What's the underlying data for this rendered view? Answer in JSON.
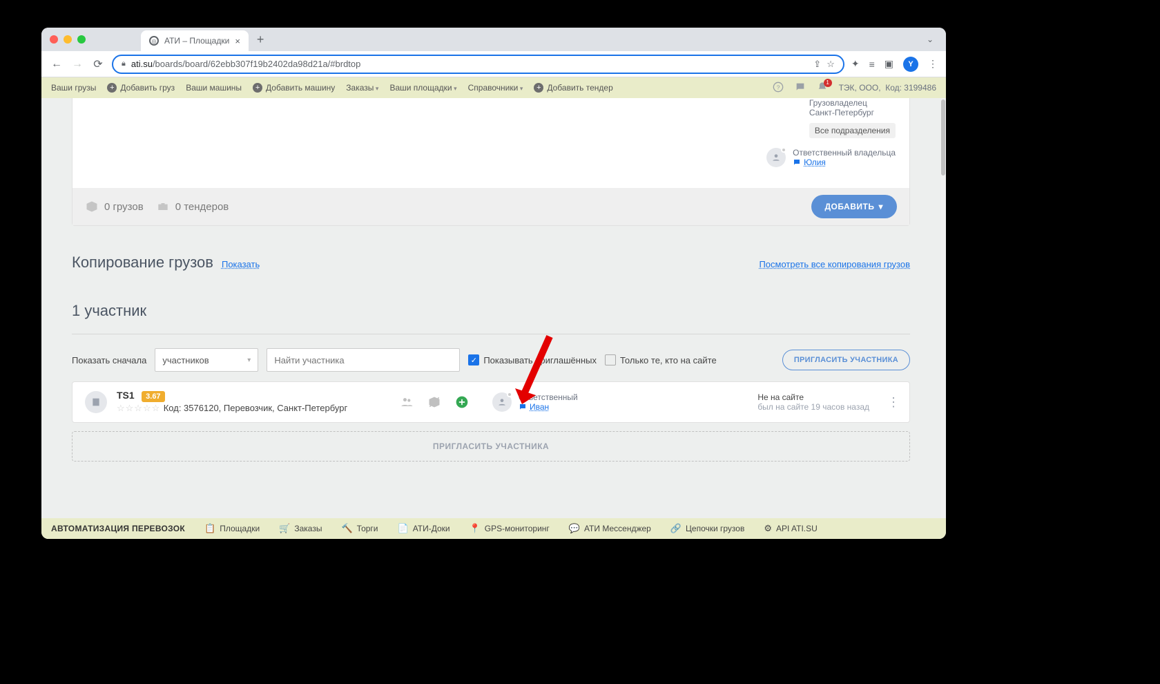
{
  "browser": {
    "tab_title": "АТИ – Площадки",
    "url_host": "ati.su",
    "url_path": "/boards/board/62ebb307f19b2402da98d21a/#brdtop"
  },
  "topnav": {
    "your_cargo": "Ваши грузы",
    "add_cargo": "Добавить груз",
    "your_vehicles": "Ваши машины",
    "add_vehicle": "Добавить машину",
    "orders": "Заказы",
    "your_boards": "Ваши площадки",
    "reference": "Справочники",
    "add_tender": "Добавить тендер",
    "org": "ТЭК, ООО,",
    "code": "Код: 3199486"
  },
  "owner": {
    "role": "Грузовладелец",
    "city": "Санкт-Петербург",
    "all_dept": "Все подразделения",
    "resp_label": "Ответственный владельца",
    "resp_name": "Юлия"
  },
  "stats": {
    "cargo": "0 грузов",
    "tenders": "0 тендеров",
    "add_btn": "ДОБАВИТЬ"
  },
  "copy": {
    "title": "Копирование грузов",
    "show": "Показать",
    "all_link": "Посмотреть все копирования грузов"
  },
  "participants": {
    "count_title": "1 участник",
    "show_first": "Показать сначала",
    "select_value": "участников",
    "search_placeholder": "Найти участника",
    "chk_invited": "Показывать приглашённых",
    "chk_online": "Только те, кто на сайте",
    "invite_btn": "ПРИГЛАСИТЬ УЧАСТНИКА",
    "row": {
      "name": "TS1",
      "rating": "3.67",
      "sub": "Код: 3576120, Перевозчик, Санкт-Петербург",
      "resp_label": "Ответственный",
      "resp_name": "Иван",
      "status_off": "Не на сайте",
      "status_ago": "был на сайте 19 часов назад"
    },
    "invite_bar": "ПРИГЛАСИТЬ УЧАСТНИКА"
  },
  "footer": {
    "title": "АВТОМАТИЗАЦИЯ ПЕРЕВОЗОК",
    "items": [
      "Площадки",
      "Заказы",
      "Торги",
      "АТИ-Доки",
      "GPS-мониторинг",
      "АТИ Мессенджер",
      "Цепочки грузов",
      "API ATI.SU"
    ]
  }
}
